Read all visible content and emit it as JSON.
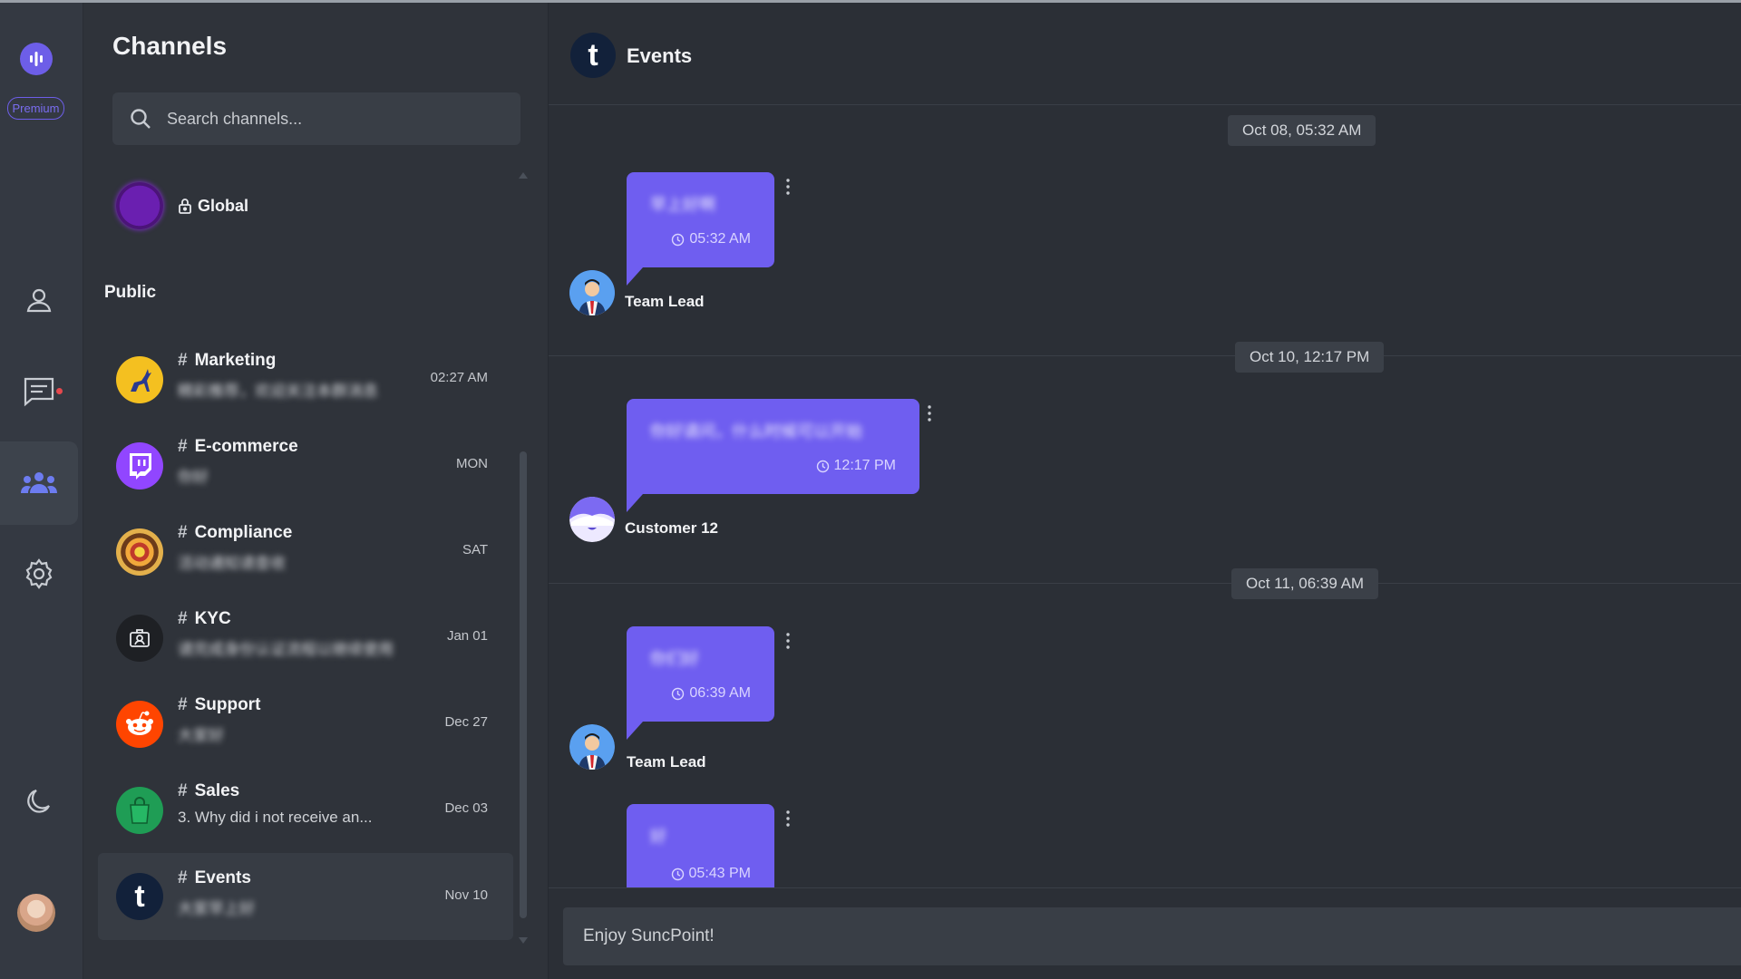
{
  "rail": {
    "premium_label": "Premium",
    "nav": [
      {
        "icon": "profile-icon"
      },
      {
        "icon": "chat-icon",
        "has_unread_dot": true
      },
      {
        "icon": "group-icon",
        "active": true
      },
      {
        "icon": "gear-icon"
      },
      {
        "icon": "moon-icon"
      }
    ],
    "accent": "#6d5ee8"
  },
  "channels_panel": {
    "title": "Channels",
    "search_placeholder": "Search channels...",
    "global": {
      "name": "Global"
    },
    "section_label": "Public",
    "channels": [
      {
        "name": "Marketing",
        "preview": "精彩推荐，欢迎关注本群消息",
        "time": "02:27 AM",
        "icon": "deer-logo"
      },
      {
        "name": "E-commerce",
        "preview": "你好",
        "time": "MON",
        "icon": "twitch-logo"
      },
      {
        "name": "Compliance",
        "preview": "活动通知请查收",
        "time": "SAT",
        "icon": "mandala-logo"
      },
      {
        "name": "KYC",
        "preview": "请完成身份认证流程以继续使用",
        "time": "Jan 01",
        "icon": "kyc-logo"
      },
      {
        "name": "Support",
        "preview": "大家好",
        "time": "Dec 27",
        "icon": "reddit-logo"
      },
      {
        "name": "Sales",
        "preview": "3. Why did i not receive an...",
        "time": "Dec 03",
        "icon": "bag-logo"
      },
      {
        "name": "Events",
        "preview": "大家早上好",
        "time": "Nov 10",
        "icon": "tumblr-logo",
        "active": true
      }
    ]
  },
  "chat": {
    "title": "Events",
    "messages": [
      {
        "date": "Oct 08, 05:32 AM",
        "text": "早上好啊",
        "time": "05:32 AM",
        "sender": "Team Lead"
      },
      {
        "date": "Oct 10, 12:17 PM",
        "text": "你好请问，什么时候可以开始",
        "time": "12:17 PM",
        "sender": "Customer 12"
      },
      {
        "date": "Oct 11, 06:39 AM",
        "text": "你们好",
        "time": "06:39 AM",
        "sender": "Team Lead"
      },
      {
        "date": "",
        "text": "好",
        "time": "05:43 PM",
        "sender": ""
      }
    ],
    "composer_placeholder": "Enjoy SuncPoint!"
  }
}
